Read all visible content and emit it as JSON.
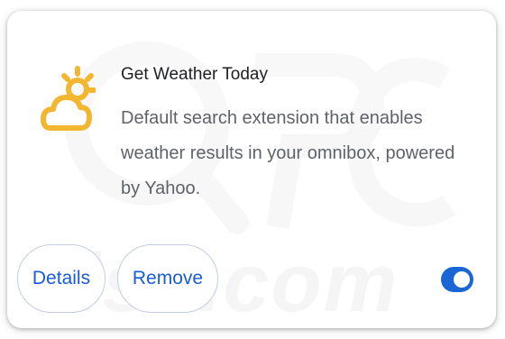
{
  "extension": {
    "name": "Get Weather Today",
    "description": "Default search extension that enables weather results in your omnibox, powered by Yahoo.",
    "icon": "sun-behind-cloud-icon",
    "enabled": true
  },
  "actions": {
    "details_label": "Details",
    "remove_label": "Remove"
  },
  "watermark": {
    "text": "risk.com"
  },
  "colors": {
    "accent": "#1a66d6",
    "icon": "#f2b630",
    "title": "#202124",
    "description": "#5f6368"
  }
}
